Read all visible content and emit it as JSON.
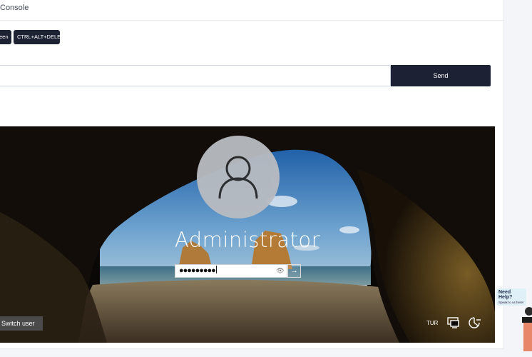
{
  "panel": {
    "title": "Console",
    "screen_button": "een",
    "ctrl_alt_delete_button": "CTRL+ALT+DELETE",
    "command_input": {
      "value": "",
      "placeholder": ""
    },
    "send_button": "Send"
  },
  "login_screen": {
    "username": "Administrator",
    "password_mask": "●●●●●●●●●",
    "switch_user": "Switch user",
    "language": "TUR"
  },
  "help_widget": {
    "title": "Need Help?",
    "subtitle": "Speak to us here!"
  },
  "colors": {
    "dark_button": "#1d2333",
    "panel_bg": "#ffffff",
    "page_bg": "#f4f5f8"
  },
  "icons": {
    "avatar": "user-silhouette-icon",
    "reveal": "eye-icon",
    "submit": "arrow-right-icon",
    "network": "network-icon",
    "ease_of_access": "ease-of-access-icon"
  }
}
